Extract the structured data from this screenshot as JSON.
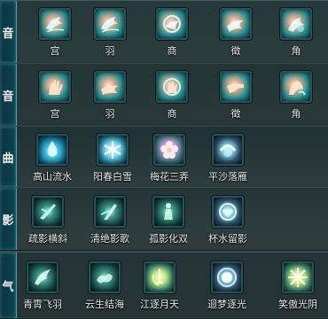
{
  "rows": [
    {
      "label": "音",
      "skills": [
        {
          "name": "宫",
          "icon": "hand-wave-icon"
        },
        {
          "name": "羽",
          "icon": "hand-wave-icon"
        },
        {
          "name": "商",
          "icon": "hand-wave-icon"
        },
        {
          "name": "徵",
          "icon": "hand-wave-icon"
        },
        {
          "name": "角",
          "icon": "hand-wave-icon"
        }
      ]
    },
    {
      "label": "音",
      "skills": [
        {
          "name": "宫",
          "icon": "open-hand-icon"
        },
        {
          "name": "羽",
          "icon": "open-hand-icon"
        },
        {
          "name": "商",
          "icon": "open-hand-icon"
        },
        {
          "name": "徵",
          "icon": "open-hand-icon"
        },
        {
          "name": "角",
          "icon": "open-hand-icon"
        }
      ]
    },
    {
      "label": "曲",
      "skills": [
        {
          "name": "高山流水",
          "icon": "water-drop-icon"
        },
        {
          "name": "阳春白雪",
          "icon": "snowflake-icon"
        },
        {
          "name": "梅花三弄",
          "icon": "plum-blossom-icon"
        },
        {
          "name": "平沙落雁",
          "icon": "crescent-ring-icon"
        }
      ]
    },
    {
      "label": "影",
      "skills": [
        {
          "name": "疏影横斜",
          "icon": "shadow-slash-icon"
        },
        {
          "name": "清绝影歌",
          "icon": "shadow-slash-icon"
        },
        {
          "name": "孤影化双",
          "icon": "shadow-figure-icon"
        },
        {
          "name": "杯水留影",
          "icon": "heart-ring-icon"
        }
      ]
    },
    {
      "label": "气",
      "skills": [
        {
          "name": "青霄飞羽",
          "icon": "flying-feather-icon"
        },
        {
          "name": "云生结海",
          "icon": "cloud-swirl-icon"
        },
        {
          "name": "江逐月天",
          "icon": "sword-moon-icon"
        },
        {
          "name": "迴梦逐光",
          "icon": "light-orb-icon"
        },
        {
          "name": "笑傲光阴",
          "icon": "light-burst-icon"
        }
      ]
    }
  ]
}
